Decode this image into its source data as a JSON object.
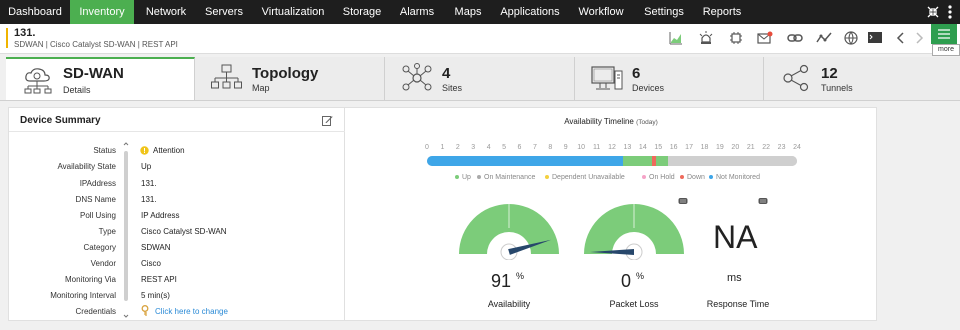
{
  "nav": {
    "items": [
      "Dashboard",
      "Inventory",
      "Network",
      "Servers",
      "Virtualization",
      "Storage",
      "Alarms",
      "Maps",
      "Applications",
      "Workflow",
      "Settings",
      "Reports"
    ],
    "active": "Inventory"
  },
  "header": {
    "title": "131.",
    "subtitle": "SDWAN | Cisco Catalyst SD-WAN | REST API",
    "more_label": "more"
  },
  "tabs": [
    {
      "title": "SD-WAN",
      "sub": "Details"
    },
    {
      "title": "Topology",
      "sub": "Map"
    },
    {
      "title": "4",
      "sub": "Sites"
    },
    {
      "title": "6",
      "sub": "Devices"
    },
    {
      "title": "12",
      "sub": "Tunnels"
    }
  ],
  "summary": {
    "title": "Device Summary",
    "rows": [
      {
        "label": "Status",
        "value": "Attention"
      },
      {
        "label": "Availability State",
        "value": "Up"
      },
      {
        "label": "IPAddress",
        "value": "131."
      },
      {
        "label": "DNS Name",
        "value": "131."
      },
      {
        "label": "Poll Using",
        "value": "IP Address"
      },
      {
        "label": "Type",
        "value": "Cisco Catalyst SD-WAN"
      },
      {
        "label": "Category",
        "value": "SDWAN"
      },
      {
        "label": "Vendor",
        "value": "Cisco"
      },
      {
        "label": "Monitoring Via",
        "value": "REST API"
      },
      {
        "label": "Monitoring Interval",
        "value": "5 min(s)"
      },
      {
        "label": "Credentials",
        "value": "Click here to change"
      }
    ]
  },
  "timeline": {
    "title": "Availability Timeline",
    "period": "(Today)",
    "hours": [
      "0",
      "1",
      "2",
      "3",
      "4",
      "5",
      "6",
      "7",
      "8",
      "9",
      "10",
      "11",
      "12",
      "13",
      "14",
      "15",
      "16",
      "17",
      "18",
      "19",
      "20",
      "21",
      "22",
      "23",
      "24"
    ],
    "segments": [
      {
        "state": "Up",
        "start": 0,
        "end": 12.7,
        "color": "#3ea6e8"
      },
      {
        "state": "Up",
        "start": 12.7,
        "end": 14.6,
        "color": "#7ccc7a"
      },
      {
        "state": "Down",
        "start": 14.6,
        "end": 14.85,
        "color": "#ef6a5c"
      },
      {
        "state": "Up",
        "start": 14.85,
        "end": 15.6,
        "color": "#7ccc7a"
      },
      {
        "state": "Not Monitored",
        "start": 15.6,
        "end": 24,
        "color": "#cfcfcf"
      }
    ],
    "legend": [
      {
        "label": "Up",
        "color": "#7ccc7a"
      },
      {
        "label": "On Maintenance",
        "color": "#aaaaaa"
      },
      {
        "label": "Dependent Unavailable",
        "color": "#f4d03f"
      },
      {
        "label": "On Hold",
        "color": "#f5a3c7"
      },
      {
        "label": "Down",
        "color": "#ef6a5c"
      },
      {
        "label": "Not Monitored",
        "color": "#3ea6e8"
      }
    ]
  },
  "metrics": {
    "availability": {
      "value": "91",
      "unit": "%",
      "label": "Availability",
      "fraction": 0.91
    },
    "packet_loss": {
      "value": "0",
      "unit": "%",
      "label": "Packet Loss",
      "fraction": 0.0
    },
    "response_time": {
      "value": "NA",
      "unit": "ms",
      "label": "Response Time"
    }
  },
  "colors": {
    "accent": "#4caf50",
    "nav_bg": "#1e1e1e",
    "gauge": "#7ccc7a",
    "needle": "#27476b",
    "link": "#2a8ad6",
    "status_attention": "#f0c419"
  }
}
